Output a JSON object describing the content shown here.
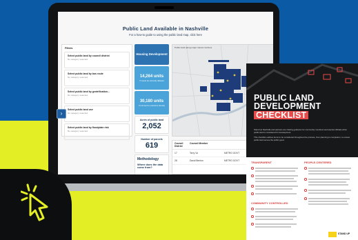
{
  "dashboard": {
    "title": "Public Land Available in Nashville",
    "subtitle": "For a how-to guide to using the public land map, click here",
    "filters": {
      "heading": "Filters",
      "items": [
        {
          "label": "Select public land by council district",
          "status": "No category selected"
        },
        {
          "label": "Select public land by bus route",
          "status": "No category selected"
        },
        {
          "label": "Select public land by gentrification...",
          "status": "No category selected"
        },
        {
          "label": "Select public land use",
          "status": "No category selected"
        },
        {
          "label": "Select public land by floodplain risk",
          "status": "No category selected"
        }
      ]
    },
    "stats": {
      "housing_label": "Housing Development",
      "units_a": "14,264 units",
      "units_a_caption": "If zoned as currently allowed",
      "units_b": "30,180 units",
      "units_b_caption": "If rezoned to maximize density",
      "acres_label": "Acres of public land",
      "acres_value": "2,052",
      "parcels_label": "Number of parcels",
      "parcels_value": "619",
      "methodology_label": "Methodology",
      "methodology_question": "Where does the data come from?"
    },
    "map": {
      "caption": "Public land along major transit corridors"
    },
    "table": {
      "headers": [
        "Council District",
        "Council Member",
        ""
      ],
      "rows": [
        [
          "17",
          "Terry Vo",
          "METRO GOVT"
        ],
        [
          "28",
          "David Benton",
          "METRO GOVT"
        ]
      ]
    }
  },
  "checklist": {
    "title_lines": [
      "PUBLIC LAND",
      "DEVELOPMENT"
    ],
    "title_highlight": "CHECKLIST",
    "intro": "Stand Up Nashville and partners are sharing guidance for community members and elected officials when public land is considered for development.",
    "intro_second": "This checklist outlines items to be considered throughout the process, from planning to completion, to ensure public land serves the public good.",
    "sections": [
      "TRANSPARENT",
      "PEOPLE-CENTERED",
      "COMMUNITY CONTROLLED"
    ],
    "brand": "STAND UP"
  },
  "colors": {
    "brand_blue": "#0b5aa5",
    "lime": "#e3ee25",
    "accent_red": "#e94b4b",
    "tile_blue": "#2d73b2",
    "tile_light": "#4aa3d9"
  },
  "icons": {
    "cursor": "cursor-click-icon",
    "nav": "arrow-right-icon"
  }
}
